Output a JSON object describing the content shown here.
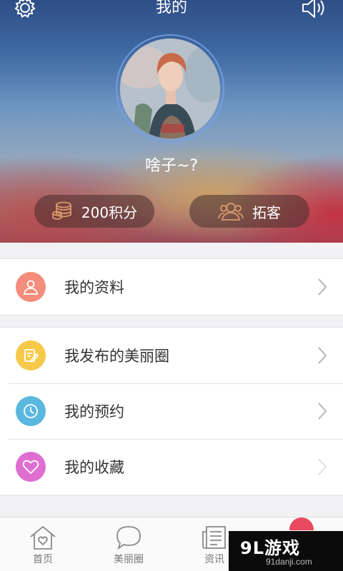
{
  "header": {
    "title": "我的",
    "left_icon": "settings-gear-icon",
    "right_icon": "speaker-icon"
  },
  "profile": {
    "username": "啥子~?",
    "avatar": "user-avatar-photo"
  },
  "stats": {
    "points_label": "200积分",
    "points_icon": "coins-icon",
    "tuoke_label": "拓客",
    "tuoke_icon": "people-icon"
  },
  "menu": {
    "groups": [
      {
        "items": [
          {
            "label": "我的资料",
            "icon": "user-icon",
            "color": "#f58d7c"
          }
        ]
      },
      {
        "items": [
          {
            "label": "我发布的美丽圈",
            "icon": "edit-note-icon",
            "color": "#f7c948"
          },
          {
            "label": "我的预约",
            "icon": "clock-icon",
            "color": "#5ab8e0"
          },
          {
            "label": "我的收藏",
            "icon": "heart-icon",
            "color": "#de6fd0"
          }
        ]
      }
    ]
  },
  "tabbar": {
    "tabs": [
      {
        "label": "首页",
        "icon": "home-heart-icon"
      },
      {
        "label": "美丽圈",
        "icon": "chat-bubble-icon"
      },
      {
        "label": "资讯",
        "icon": "news-icon"
      },
      {
        "label": "",
        "icon": "badge-icon"
      }
    ]
  },
  "watermark": {
    "main": "9L游戏",
    "sub": "91danji.com"
  },
  "colors": {
    "accent_points": "#d99a6c",
    "text_dark": "#333333",
    "divider": "#e6e6e8"
  }
}
